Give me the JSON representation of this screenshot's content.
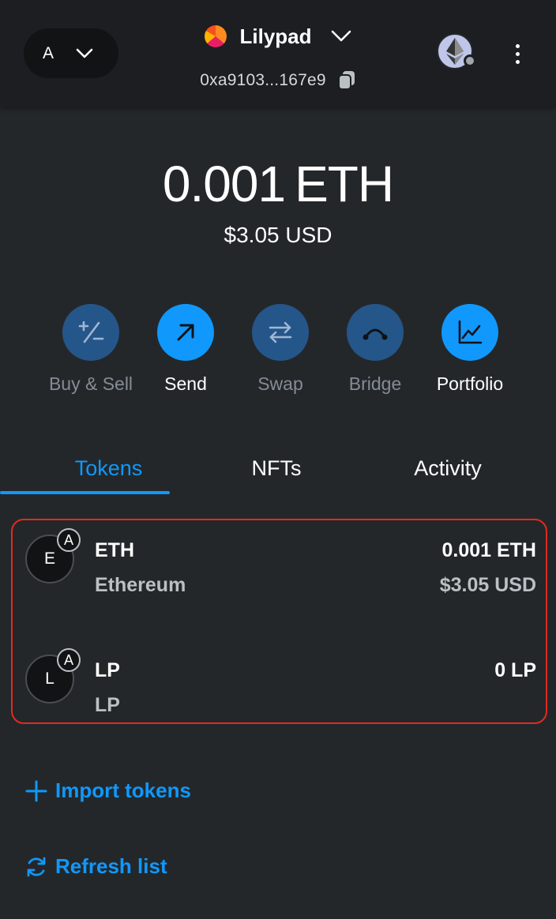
{
  "header": {
    "network_letter": "A",
    "account_name": "Lilypad",
    "address": "0xa9103...167e9"
  },
  "balance": {
    "primary_value": "0.001",
    "primary_unit": "ETH",
    "secondary": "$3.05 USD"
  },
  "actions": [
    {
      "label": "Buy & Sell",
      "icon": "plus-minus-icon",
      "enabled": false
    },
    {
      "label": "Send",
      "icon": "arrow-up-right-icon",
      "enabled": true
    },
    {
      "label": "Swap",
      "icon": "swap-arrows-icon",
      "enabled": false
    },
    {
      "label": "Bridge",
      "icon": "bridge-arc-icon",
      "enabled": false
    },
    {
      "label": "Portfolio",
      "icon": "chart-line-icon",
      "enabled": true
    }
  ],
  "tabs": [
    {
      "label": "Tokens",
      "active": true
    },
    {
      "label": "NFTs",
      "active": false
    },
    {
      "label": "Activity",
      "active": false
    }
  ],
  "tokens": [
    {
      "icon_letter": "E",
      "badge": "A",
      "symbol": "ETH",
      "name": "Ethereum",
      "balance": "0.001 ETH",
      "fiat": "$3.05 USD"
    },
    {
      "icon_letter": "L",
      "badge": "A",
      "symbol": "LP",
      "name": "LP",
      "balance": "0 LP",
      "fiat": ""
    }
  ],
  "links": {
    "import_tokens": "Import tokens",
    "refresh_list": "Refresh list"
  },
  "colors": {
    "background": "#24272a",
    "header": "#1c1e21",
    "accent": "#1098fc",
    "action_disabled": "#25568a",
    "highlight_border": "#e12b1f"
  }
}
